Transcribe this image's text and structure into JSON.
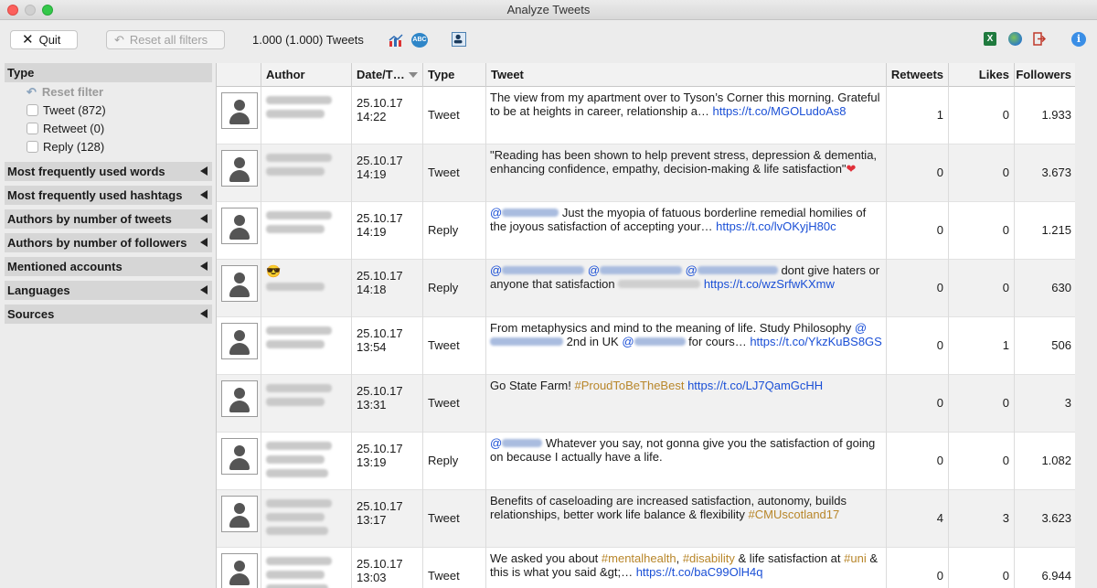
{
  "window": {
    "title": "Analyze Tweets"
  },
  "toolbar": {
    "quit_label": "Quit",
    "reset_label": "Reset all filters",
    "tweet_count": "1.000 (1.000) Tweets"
  },
  "sidebar": {
    "type_header": "Type",
    "reset_filter": "Reset filter",
    "type_options": [
      "Tweet (872)",
      "Retweet (0)",
      "Reply (128)"
    ],
    "sections": [
      "Most frequently used words",
      "Most frequently used hashtags",
      "Authors by number of tweets",
      "Authors by number of followers",
      "Mentioned accounts",
      "Languages",
      "Sources"
    ]
  },
  "table": {
    "columns": {
      "author": "Author",
      "date": "Date/T…",
      "type": "Type",
      "tweet": "Tweet",
      "retweets": "Retweets",
      "likes": "Likes",
      "followers": "Followers"
    },
    "rows": [
      {
        "date": "25.10.17",
        "time": "14:22",
        "type": "Tweet",
        "tweet_parts": [
          {
            "t": "The view from my apartment over to Tyson’s Corner this morning. Grateful to be at heights in career, relationship a… "
          },
          {
            "t": "https://t.co/MGOLudoAs8",
            "k": "link"
          }
        ],
        "retweets": "1",
        "likes": "0",
        "followers": "1.933"
      },
      {
        "date": "25.10.17",
        "time": "14:19",
        "type": "Tweet",
        "tweet_parts": [
          {
            "t": "\"Reading has been shown to help prevent stress, depression & dementia, enhancing confidence, empathy, decision-making & life satisfaction\""
          },
          {
            "t": "❤",
            "k": "heart"
          }
        ],
        "retweets": "0",
        "likes": "0",
        "followers": "3.673"
      },
      {
        "date": "25.10.17",
        "time": "14:19",
        "type": "Reply",
        "tweet_parts": [
          {
            "t": "@",
            "k": "mention"
          },
          {
            "t": "",
            "k": "blur",
            "w": 62
          },
          {
            "t": " Just the myopia of fatuous borderline remedial homilies of the joyous satisfaction of accepting your… "
          },
          {
            "t": "https://t.co/lvOKyjH80c",
            "k": "link"
          }
        ],
        "retweets": "0",
        "likes": "0",
        "followers": "1.215"
      },
      {
        "date": "25.10.17",
        "time": "14:18",
        "type": "Reply",
        "tweet_parts": [
          {
            "t": "@",
            "k": "mention"
          },
          {
            "t": "",
            "k": "blur",
            "w": 90
          },
          {
            "t": " @",
            "k": "mention"
          },
          {
            "t": "",
            "k": "blur",
            "w": 90
          },
          {
            "t": " @",
            "k": "mention"
          },
          {
            "t": "",
            "k": "blur",
            "w": 88
          },
          {
            "t": " dont give haters or anyone that satisfaction "
          },
          {
            "t": "",
            "k": "blurgray",
            "w": 90
          },
          {
            "t": " "
          },
          {
            "t": "https://t.co/wzSrfwKXmw",
            "k": "link"
          }
        ],
        "retweets": "0",
        "likes": "0",
        "followers": "630"
      },
      {
        "date": "25.10.17",
        "time": "13:54",
        "type": "Tweet",
        "tweet_parts": [
          {
            "t": "From metaphysics and mind to the meaning of life. Study Philosophy "
          },
          {
            "t": "@",
            "k": "mention"
          },
          {
            "t": "",
            "k": "blur",
            "w": 80
          },
          {
            "t": " 2nd in UK "
          },
          {
            "t": "@",
            "k": "mention"
          },
          {
            "t": "",
            "k": "blur",
            "w": 56
          },
          {
            "t": " for cours… "
          },
          {
            "t": "https://t.co/YkzKuBS8GS",
            "k": "link"
          }
        ],
        "retweets": "0",
        "likes": "1",
        "followers": "506"
      },
      {
        "date": "25.10.17",
        "time": "13:31",
        "type": "Tweet",
        "tweet_parts": [
          {
            "t": "Go State Farm! "
          },
          {
            "t": "#ProudToBeTheBest",
            "k": "tag"
          },
          {
            "t": " "
          },
          {
            "t": "https://t.co/LJ7QamGcHH",
            "k": "link"
          }
        ],
        "retweets": "0",
        "likes": "0",
        "followers": "3"
      },
      {
        "date": "25.10.17",
        "time": "13:19",
        "type": "Reply",
        "tweet_parts": [
          {
            "t": "@",
            "k": "mention"
          },
          {
            "t": "",
            "k": "blur",
            "w": 44
          },
          {
            "t": " Whatever you say, not gonna give you the satisfaction of going on because I actually have a life."
          }
        ],
        "retweets": "0",
        "likes": "0",
        "followers": "1.082"
      },
      {
        "date": "25.10.17",
        "time": "13:17",
        "type": "Tweet",
        "tweet_parts": [
          {
            "t": "Benefits of caseloading are increased satisfaction, autonomy, builds relationships, better work life balance & flexibility "
          },
          {
            "t": "#CMUscotland17",
            "k": "tag"
          }
        ],
        "retweets": "4",
        "likes": "3",
        "followers": "3.623"
      },
      {
        "date": "25.10.17",
        "time": "13:03",
        "type": "Tweet",
        "tweet_parts": [
          {
            "t": "We asked you about "
          },
          {
            "t": "#mentalhealth",
            "k": "tag"
          },
          {
            "t": ", "
          },
          {
            "t": "#disability",
            "k": "tag"
          },
          {
            "t": " & life satisfaction at "
          },
          {
            "t": "#uni",
            "k": "tag"
          },
          {
            "t": " & this is what you said &gt;… "
          },
          {
            "t": "https://t.co/baC99OlH4q",
            "k": "link"
          }
        ],
        "retweets": "0",
        "likes": "0",
        "followers": "6.944"
      }
    ]
  },
  "colors": {
    "link": "#1a4fd6",
    "hashtag": "#b8862a",
    "alt_row": "#f1f1f1",
    "header_bg": "#d6d6d6"
  }
}
